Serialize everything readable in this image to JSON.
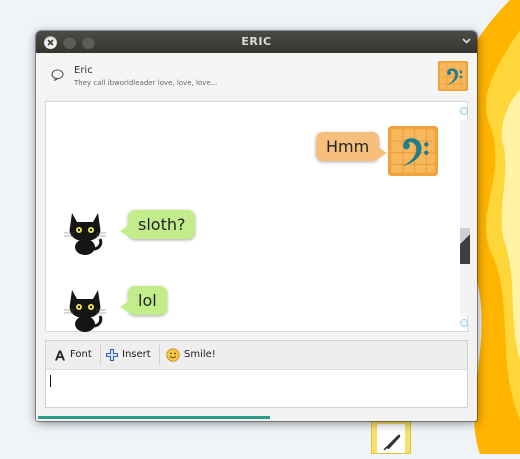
{
  "window": {
    "title": "ERIC"
  },
  "contact": {
    "name": "Eric",
    "status_message": "They call ibworldleader love, love, love..."
  },
  "messages": [
    {
      "sender": "me",
      "text": "Hmm"
    },
    {
      "sender": "them",
      "text": "sloth?"
    },
    {
      "sender": "them",
      "text": "lol"
    }
  ],
  "toolbar": {
    "font_label": "Font",
    "insert_label": "Insert",
    "smile_label": "Smile!"
  },
  "input": {
    "value": ""
  },
  "colors": {
    "my_bubble": "#f6c07c",
    "their_bubble": "#c2ed8a",
    "titlebar": "#3c3b37"
  },
  "icons": {
    "header_avatar": "bass-clef-icon",
    "contact_avatar": "black-cat-icon",
    "status": "speech-bubble-icon"
  }
}
